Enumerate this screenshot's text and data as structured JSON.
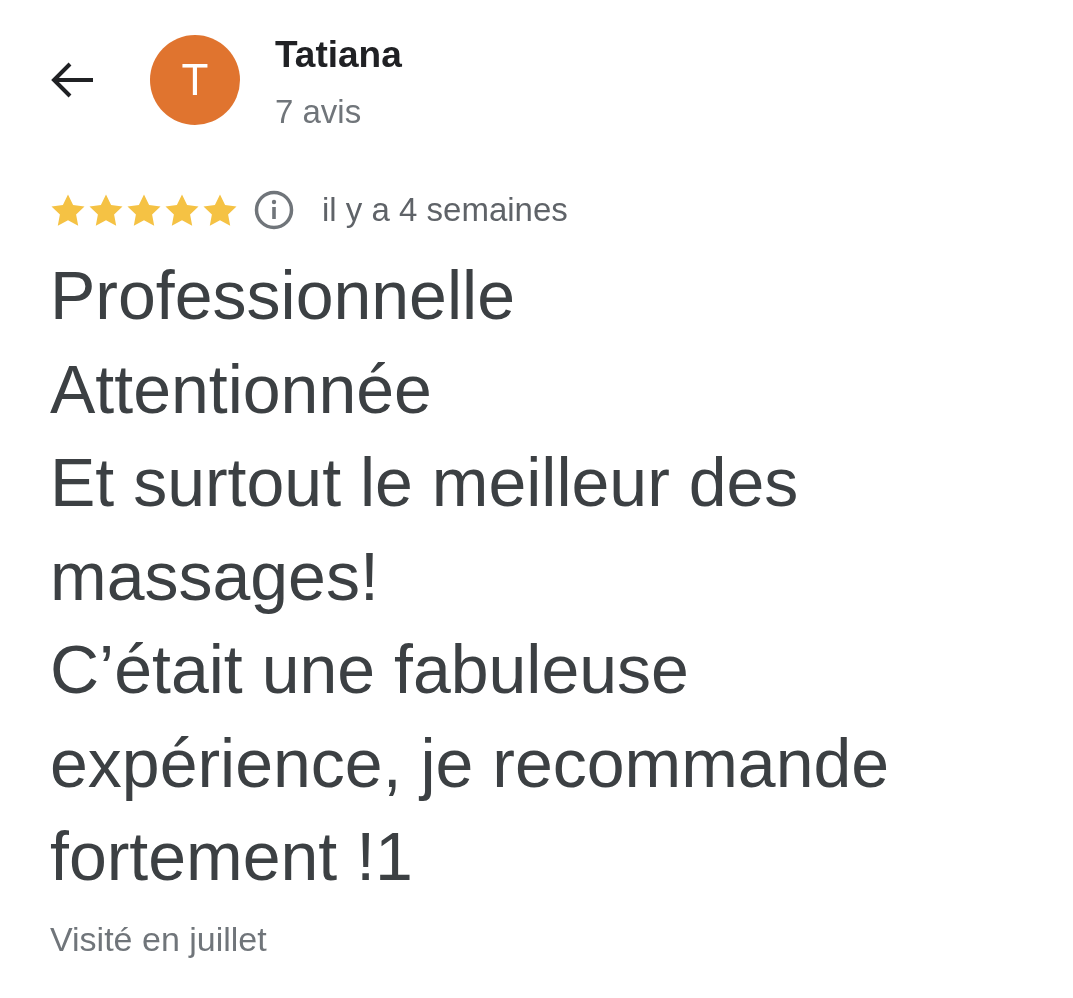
{
  "reviewer": {
    "initial": "T",
    "name": "Tatiana",
    "review_count": "7 avis"
  },
  "review": {
    "stars": 5,
    "time": "il y a 4 semaines",
    "text": "Professionnelle\nAttentionnée\nEt surtout le meilleur des massages!\nC’était une fabuleuse expérience, je recommande fortement !1",
    "visit": "Visité en juillet"
  }
}
